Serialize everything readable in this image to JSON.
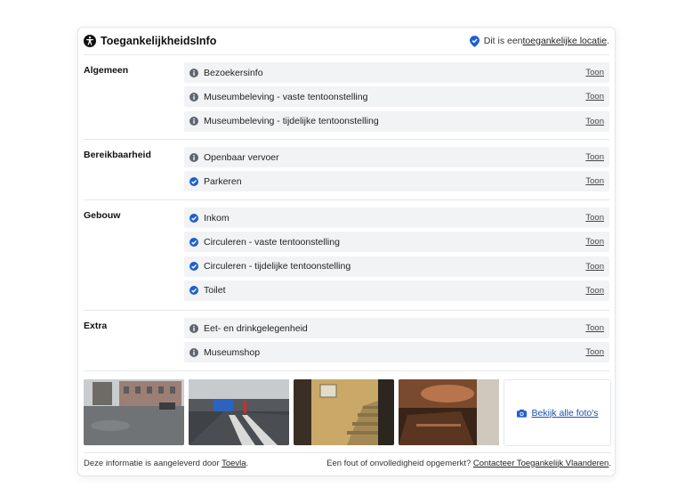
{
  "header": {
    "title": "ToegankelijkheidsInfo",
    "location_prefix": "Dit is een ",
    "location_link": "toegankelijke locatie",
    "location_suffix": "."
  },
  "sections": [
    {
      "title": "Algemeen",
      "rows": [
        {
          "label": "Bezoekersinfo",
          "icon": "info-icon",
          "action": "Toon"
        },
        {
          "label": "Museumbeleving - vaste tentoonstelling",
          "icon": "info-icon",
          "action": "Toon"
        },
        {
          "label": "Museumbeleving - tijdelijke tentoonstelling",
          "icon": "info-icon",
          "action": "Toon"
        }
      ]
    },
    {
      "title": "Bereikbaarheid",
      "rows": [
        {
          "label": "Openbaar vervoer",
          "icon": "info-icon",
          "action": "Toon"
        },
        {
          "label": "Parkeren",
          "icon": "check-icon",
          "action": "Toon"
        }
      ]
    },
    {
      "title": "Gebouw",
      "rows": [
        {
          "label": "Inkom",
          "icon": "check-icon",
          "action": "Toon"
        },
        {
          "label": "Circuleren - vaste tentoonstelling",
          "icon": "check-icon",
          "action": "Toon"
        },
        {
          "label": "Circuleren - tijdelijke tentoonstelling",
          "icon": "check-icon",
          "action": "Toon"
        },
        {
          "label": "Toilet",
          "icon": "check-icon",
          "action": "Toon"
        }
      ]
    },
    {
      "title": "Extra",
      "rows": [
        {
          "label": "Eet- en drinkgelegenheid",
          "icon": "info-icon",
          "action": "Toon"
        },
        {
          "label": "Museumshop",
          "icon": "info-icon",
          "action": "Toon"
        }
      ]
    }
  ],
  "photos": {
    "all_label": "Bekijk alle foto's"
  },
  "footer": {
    "left_prefix": "Deze informatie is aangeleverd door ",
    "left_link": "Toevla",
    "left_suffix": ".",
    "right_prefix": "Een fout of onvolledigheid opgemerkt? ",
    "right_link": "Contacteer Toegankelijk Vlaanderen",
    "right_suffix": "."
  },
  "colors": {
    "accent": "#1f5fce",
    "row_background": "#f2f3f5",
    "info_icon": "#5f6670"
  }
}
